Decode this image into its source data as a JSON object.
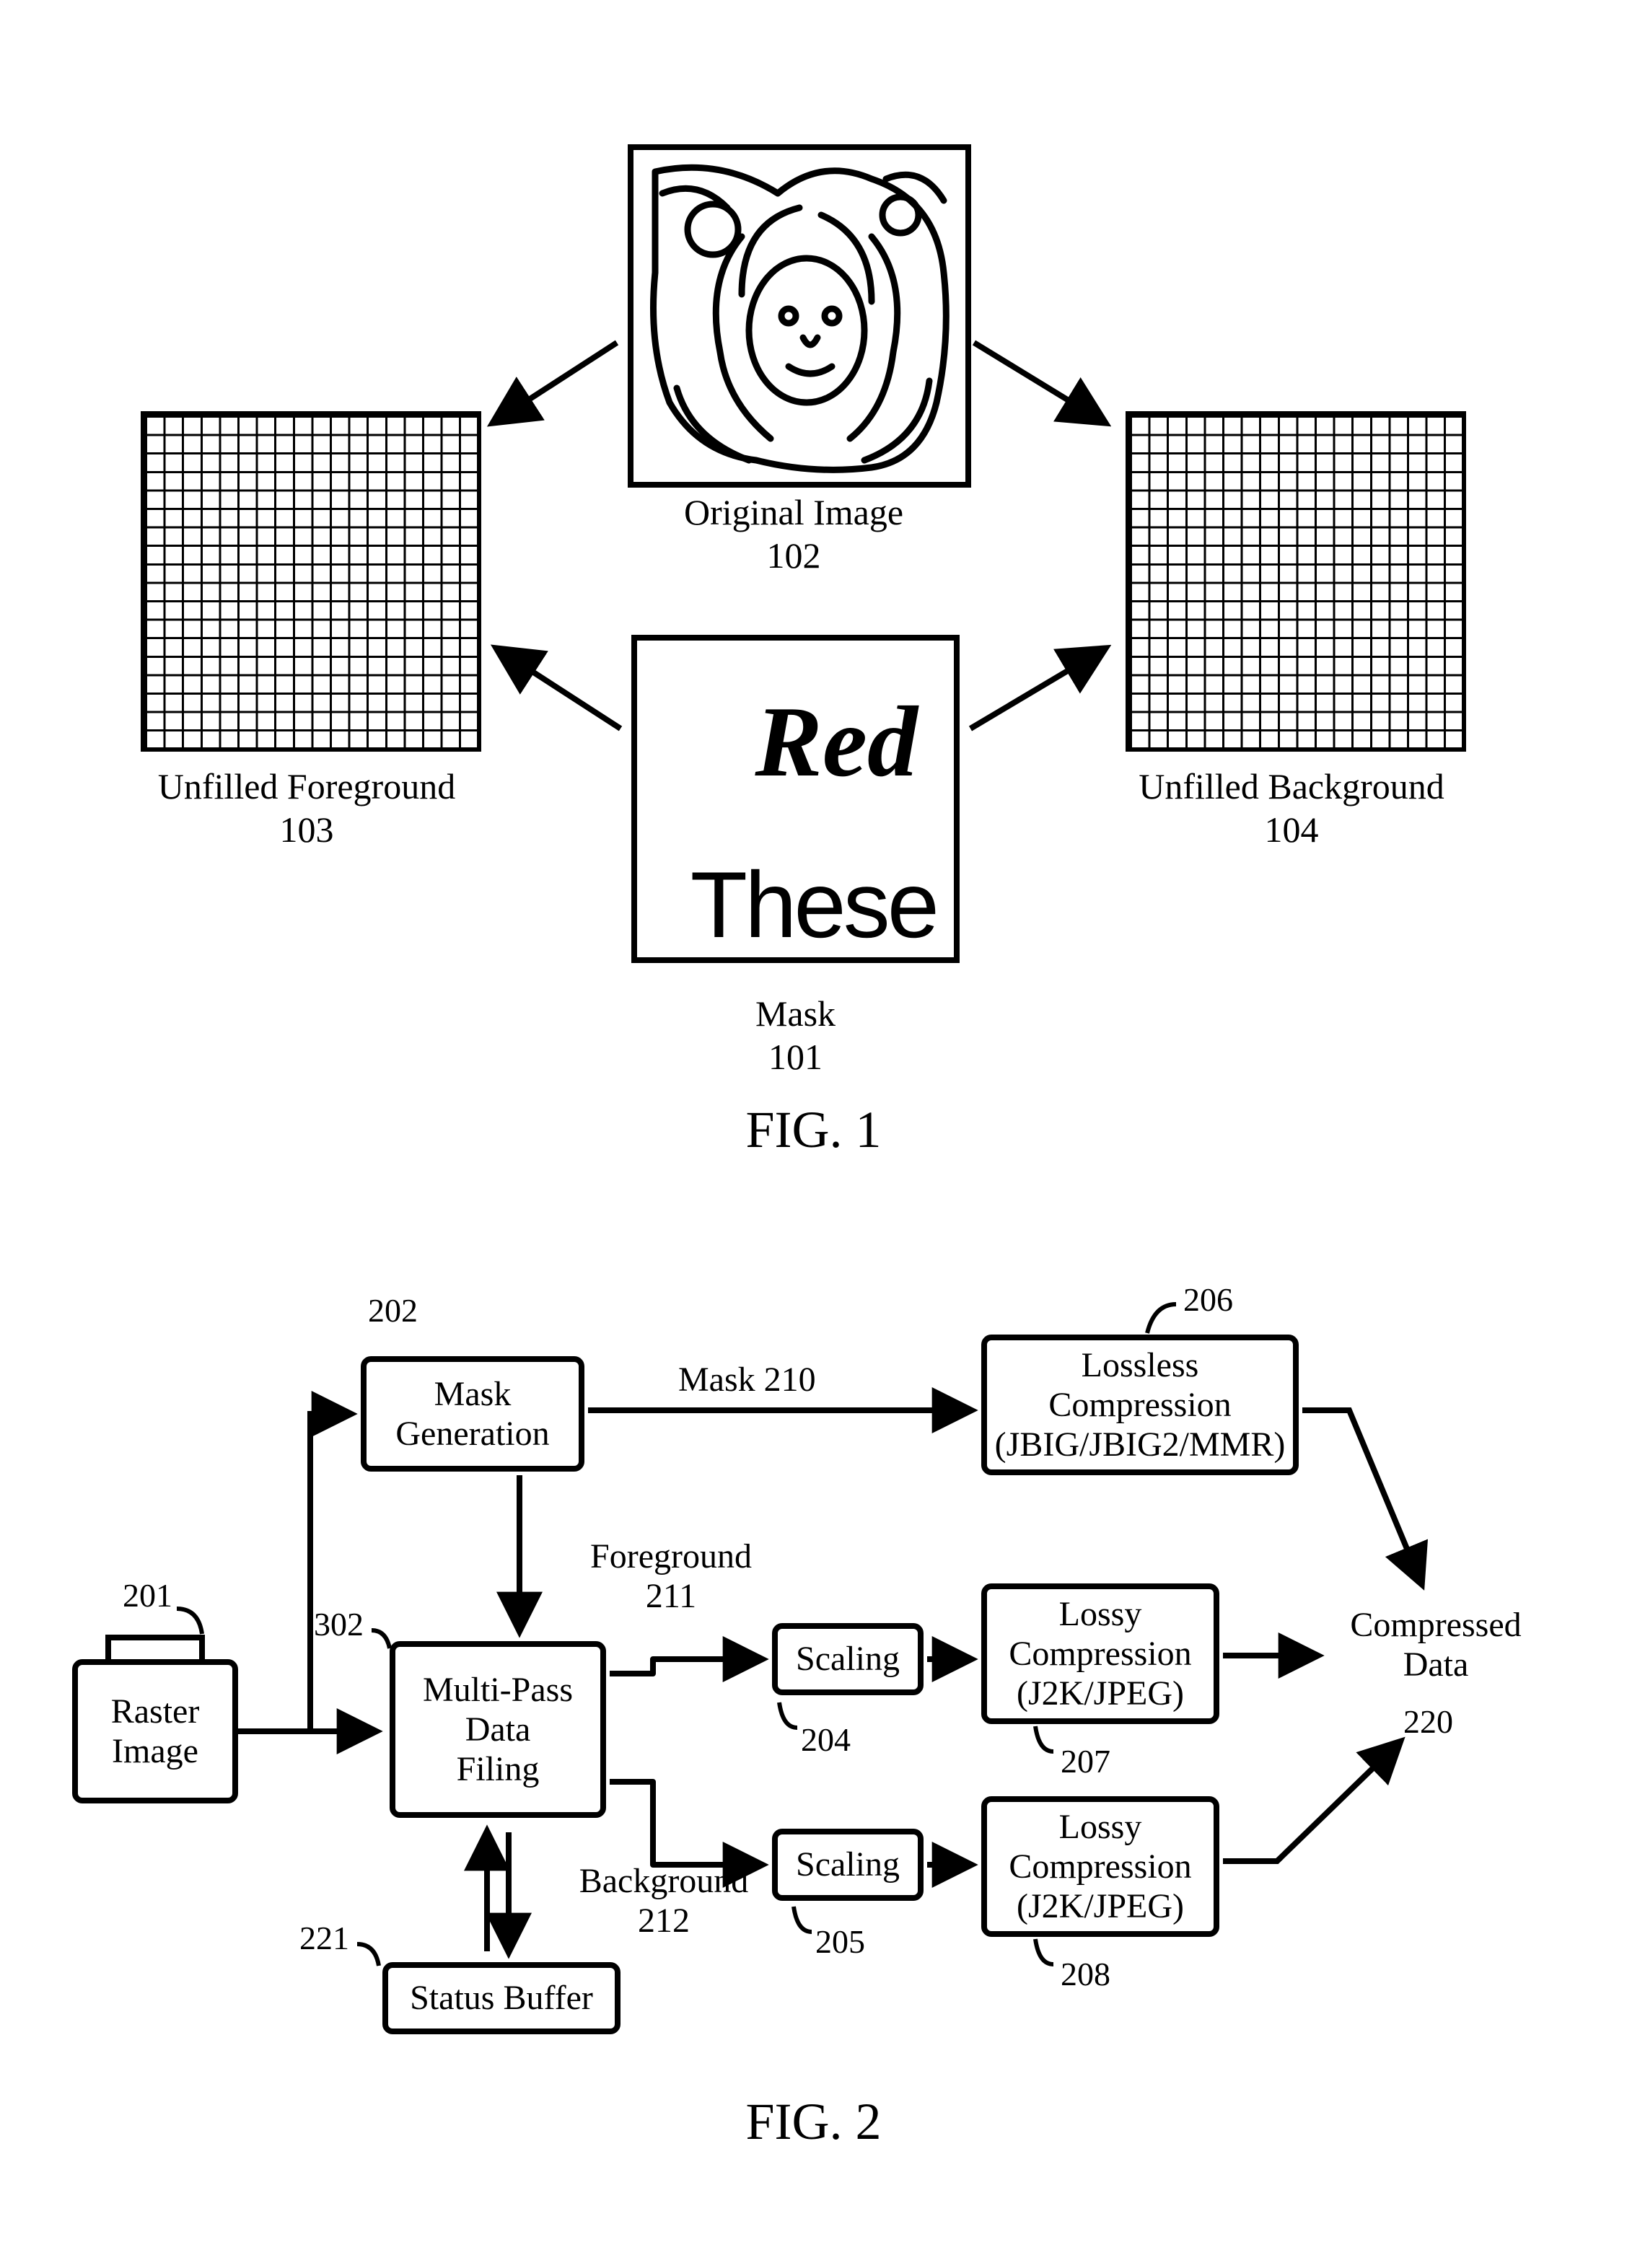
{
  "fig1": {
    "title": "FIG. 1",
    "original_image": {
      "label": "Original Image",
      "ref": "102"
    },
    "mask": {
      "label": "Mask",
      "ref": "101",
      "text_top": "Red",
      "text_bottom": "These"
    },
    "unfilled_fg": {
      "label": "Unfilled Foreground",
      "ref": "103"
    },
    "unfilled_bg": {
      "label": "Unfilled Background",
      "ref": "104"
    }
  },
  "fig2": {
    "title": "FIG. 2",
    "raster_image": {
      "label": "Raster\nImage",
      "ref": "201"
    },
    "mask_gen": {
      "label": "Mask\nGeneration",
      "ref": "202"
    },
    "multipass": {
      "label": "Multi-Pass\nData\nFiling",
      "ref": "302"
    },
    "status_buffer": {
      "label": "Status Buffer",
      "ref": "221"
    },
    "scaling_top": {
      "label": "Scaling",
      "ref": "204"
    },
    "scaling_bot": {
      "label": "Scaling",
      "ref": "205"
    },
    "lossless": {
      "label": "Lossless\nCompression\n(JBIG/JBIG2/MMR)",
      "ref": "206"
    },
    "lossy_top": {
      "label": "Lossy\nCompression\n(J2K/JPEG)",
      "ref": "207"
    },
    "lossy_bot": {
      "label": "Lossy\nCompression\n(J2K/JPEG)",
      "ref": "208"
    },
    "compressed": {
      "label": "Compressed\nData",
      "ref": "220"
    },
    "edge_mask": "Mask 210",
    "edge_fg": {
      "label": "Foreground",
      "ref": "211"
    },
    "edge_bg": {
      "label": "Background",
      "ref": "212"
    }
  }
}
